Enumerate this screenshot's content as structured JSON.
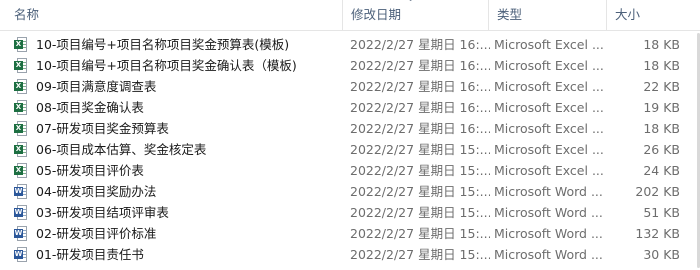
{
  "columns": {
    "name": "名称",
    "date": "修改日期",
    "type": "类型",
    "size": "大小"
  },
  "sort_indicator": "chevron-up-icon",
  "files": [
    {
      "name": "10-项目编号+项目名称项目奖金预算表(模板)",
      "date": "2022/2/27 星期日 16:...",
      "type": "Microsoft Excel ...",
      "size": "18 KB",
      "icon": "excel-file-icon"
    },
    {
      "name": "10-项目编号+项目名称项目奖金确认表（模板)",
      "date": "2022/2/27 星期日 16:...",
      "type": "Microsoft Excel ...",
      "size": "18 KB",
      "icon": "excel-file-icon"
    },
    {
      "name": "09-项目满意度调查表",
      "date": "2022/2/27 星期日 16:...",
      "type": "Microsoft Excel ...",
      "size": "22 KB",
      "icon": "excel-file-icon"
    },
    {
      "name": "08-项目奖金确认表",
      "date": "2022/2/27 星期日 16:...",
      "type": "Microsoft Excel ...",
      "size": "19 KB",
      "icon": "excel-file-icon"
    },
    {
      "name": "07-研发项目奖金预算表",
      "date": "2022/2/27 星期日 16:...",
      "type": "Microsoft Excel ...",
      "size": "18 KB",
      "icon": "excel-file-icon"
    },
    {
      "name": "06-项目成本估算、奖金核定表",
      "date": "2022/2/27 星期日 15:...",
      "type": "Microsoft Excel ...",
      "size": "26 KB",
      "icon": "excel-file-icon"
    },
    {
      "name": "05-研发项目评价表",
      "date": "2022/2/27 星期日 15:...",
      "type": "Microsoft Excel ...",
      "size": "24 KB",
      "icon": "excel-file-icon"
    },
    {
      "name": "04-研发项目奖励办法",
      "date": "2022/2/27 星期日 15:...",
      "type": "Microsoft Word ...",
      "size": "202 KB",
      "icon": "word-file-icon"
    },
    {
      "name": "03-研发项目结项评审表",
      "date": "2022/2/27 星期日 15:...",
      "type": "Microsoft Word ...",
      "size": "51 KB",
      "icon": "word-file-icon"
    },
    {
      "name": "02-研发项目评价标准",
      "date": "2022/2/27 星期日 15:...",
      "type": "Microsoft Word ...",
      "size": "132 KB",
      "icon": "word-file-icon"
    },
    {
      "name": "01-研发项目责任书",
      "date": "2022/2/27 星期日 15:...",
      "type": "Microsoft Word ...",
      "size": "30 KB",
      "icon": "word-file-icon"
    }
  ],
  "colors": {
    "header_text": "#4c607a",
    "excel_green": "#1d6f42",
    "word_blue": "#2b579a"
  }
}
